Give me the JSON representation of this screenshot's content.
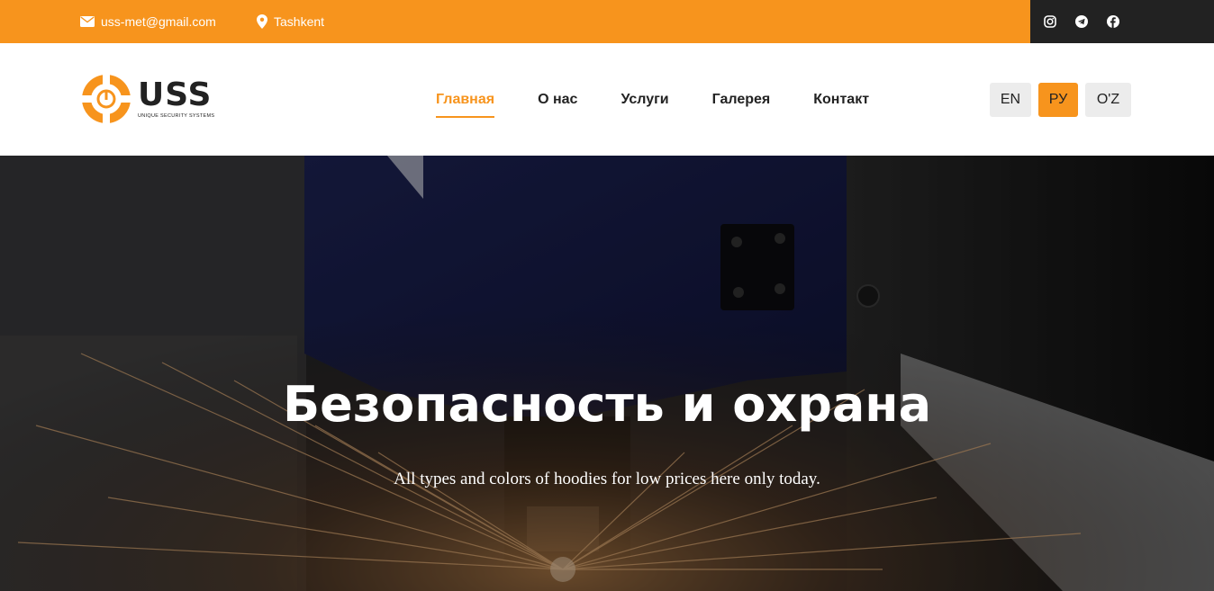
{
  "colors": {
    "accent": "#f7941d",
    "dark": "#222222",
    "lang_bg": "#ececec"
  },
  "topbar": {
    "email": {
      "icon": "envelope-icon",
      "text": "uss-met@gmail.com"
    },
    "location": {
      "icon": "map-pin-icon",
      "text": "Tashkent"
    },
    "social": [
      "instagram-icon",
      "telegram-icon",
      "facebook-icon"
    ]
  },
  "logo": {
    "name": "USS",
    "tagline": "UNIQUE SECURITY SYSTEMS"
  },
  "nav": {
    "items": [
      {
        "label": "Главная",
        "active": true
      },
      {
        "label": "О нас",
        "active": false
      },
      {
        "label": "Услуги",
        "active": false
      },
      {
        "label": "Галерея",
        "active": false
      },
      {
        "label": "Контакт",
        "active": false
      }
    ]
  },
  "languages": {
    "items": [
      "EN",
      "РУ",
      "O'Z"
    ],
    "selected": "РУ"
  },
  "hero": {
    "title": "Безопасность и охрана",
    "subtitle": "All types and colors of hoodies for low prices here only today."
  }
}
